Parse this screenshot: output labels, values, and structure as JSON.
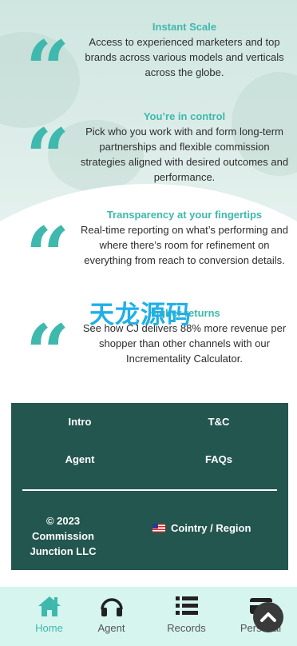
{
  "features": [
    {
      "title": "Instant Scale",
      "text": "Access to experienced marketers and top brands across various models and verticals across the globe."
    },
    {
      "title": "You’re in control",
      "text": "Pick who you work with and form long-term partnerships and flexible commission strategies aligned with desired outcomes and performance."
    },
    {
      "title": "Transparency at your fingertips",
      "text": "Real-time reporting on what’s performing and where there’s room for refinement on everything from reach to conversion details."
    },
    {
      "title": "Higher returns",
      "text": "See how CJ delivers 88% more revenue per shopper than other channels with our Incrementality Calculator."
    }
  ],
  "quote_glyph": "“",
  "watermark": "天龙源码",
  "footer": {
    "links": {
      "intro": "Intro",
      "tc": "T&C",
      "agent": "Agent",
      "faqs": "FAQs"
    },
    "copyright": "© 2023 Commission Junction LLC",
    "region": "Cointry / Region"
  },
  "tabbar": {
    "home": "Home",
    "agent": "Agent",
    "records": "Records",
    "personal": "Personal"
  },
  "colors": {
    "accent": "#3fb8ad",
    "footer_bg": "#245650",
    "tabbar_bg": "#d6f5ef"
  },
  "icons": [
    "quote-icon",
    "us-flag-icon",
    "home-icon",
    "headphones-icon",
    "list-icon",
    "card-icon",
    "chevron-up-icon"
  ]
}
